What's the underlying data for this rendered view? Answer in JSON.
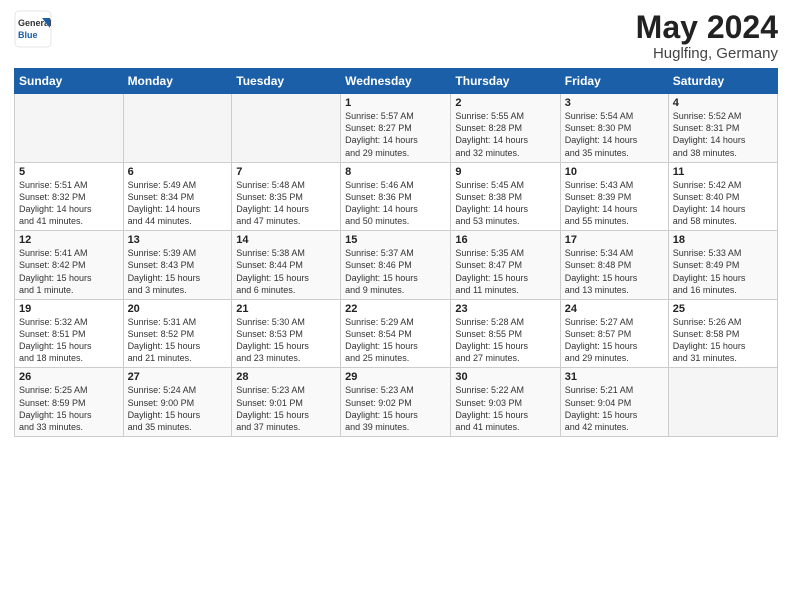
{
  "header": {
    "logo_general": "General",
    "logo_blue": "Blue",
    "title": "May 2024",
    "location": "Huglfing, Germany"
  },
  "days_of_week": [
    "Sunday",
    "Monday",
    "Tuesday",
    "Wednesday",
    "Thursday",
    "Friday",
    "Saturday"
  ],
  "weeks": [
    [
      {
        "day": "",
        "content": ""
      },
      {
        "day": "",
        "content": ""
      },
      {
        "day": "",
        "content": ""
      },
      {
        "day": "1",
        "content": "Sunrise: 5:57 AM\nSunset: 8:27 PM\nDaylight: 14 hours\nand 29 minutes."
      },
      {
        "day": "2",
        "content": "Sunrise: 5:55 AM\nSunset: 8:28 PM\nDaylight: 14 hours\nand 32 minutes."
      },
      {
        "day": "3",
        "content": "Sunrise: 5:54 AM\nSunset: 8:30 PM\nDaylight: 14 hours\nand 35 minutes."
      },
      {
        "day": "4",
        "content": "Sunrise: 5:52 AM\nSunset: 8:31 PM\nDaylight: 14 hours\nand 38 minutes."
      }
    ],
    [
      {
        "day": "5",
        "content": "Sunrise: 5:51 AM\nSunset: 8:32 PM\nDaylight: 14 hours\nand 41 minutes."
      },
      {
        "day": "6",
        "content": "Sunrise: 5:49 AM\nSunset: 8:34 PM\nDaylight: 14 hours\nand 44 minutes."
      },
      {
        "day": "7",
        "content": "Sunrise: 5:48 AM\nSunset: 8:35 PM\nDaylight: 14 hours\nand 47 minutes."
      },
      {
        "day": "8",
        "content": "Sunrise: 5:46 AM\nSunset: 8:36 PM\nDaylight: 14 hours\nand 50 minutes."
      },
      {
        "day": "9",
        "content": "Sunrise: 5:45 AM\nSunset: 8:38 PM\nDaylight: 14 hours\nand 53 minutes."
      },
      {
        "day": "10",
        "content": "Sunrise: 5:43 AM\nSunset: 8:39 PM\nDaylight: 14 hours\nand 55 minutes."
      },
      {
        "day": "11",
        "content": "Sunrise: 5:42 AM\nSunset: 8:40 PM\nDaylight: 14 hours\nand 58 minutes."
      }
    ],
    [
      {
        "day": "12",
        "content": "Sunrise: 5:41 AM\nSunset: 8:42 PM\nDaylight: 15 hours\nand 1 minute."
      },
      {
        "day": "13",
        "content": "Sunrise: 5:39 AM\nSunset: 8:43 PM\nDaylight: 15 hours\nand 3 minutes."
      },
      {
        "day": "14",
        "content": "Sunrise: 5:38 AM\nSunset: 8:44 PM\nDaylight: 15 hours\nand 6 minutes."
      },
      {
        "day": "15",
        "content": "Sunrise: 5:37 AM\nSunset: 8:46 PM\nDaylight: 15 hours\nand 9 minutes."
      },
      {
        "day": "16",
        "content": "Sunrise: 5:35 AM\nSunset: 8:47 PM\nDaylight: 15 hours\nand 11 minutes."
      },
      {
        "day": "17",
        "content": "Sunrise: 5:34 AM\nSunset: 8:48 PM\nDaylight: 15 hours\nand 13 minutes."
      },
      {
        "day": "18",
        "content": "Sunrise: 5:33 AM\nSunset: 8:49 PM\nDaylight: 15 hours\nand 16 minutes."
      }
    ],
    [
      {
        "day": "19",
        "content": "Sunrise: 5:32 AM\nSunset: 8:51 PM\nDaylight: 15 hours\nand 18 minutes."
      },
      {
        "day": "20",
        "content": "Sunrise: 5:31 AM\nSunset: 8:52 PM\nDaylight: 15 hours\nand 21 minutes."
      },
      {
        "day": "21",
        "content": "Sunrise: 5:30 AM\nSunset: 8:53 PM\nDaylight: 15 hours\nand 23 minutes."
      },
      {
        "day": "22",
        "content": "Sunrise: 5:29 AM\nSunset: 8:54 PM\nDaylight: 15 hours\nand 25 minutes."
      },
      {
        "day": "23",
        "content": "Sunrise: 5:28 AM\nSunset: 8:55 PM\nDaylight: 15 hours\nand 27 minutes."
      },
      {
        "day": "24",
        "content": "Sunrise: 5:27 AM\nSunset: 8:57 PM\nDaylight: 15 hours\nand 29 minutes."
      },
      {
        "day": "25",
        "content": "Sunrise: 5:26 AM\nSunset: 8:58 PM\nDaylight: 15 hours\nand 31 minutes."
      }
    ],
    [
      {
        "day": "26",
        "content": "Sunrise: 5:25 AM\nSunset: 8:59 PM\nDaylight: 15 hours\nand 33 minutes."
      },
      {
        "day": "27",
        "content": "Sunrise: 5:24 AM\nSunset: 9:00 PM\nDaylight: 15 hours\nand 35 minutes."
      },
      {
        "day": "28",
        "content": "Sunrise: 5:23 AM\nSunset: 9:01 PM\nDaylight: 15 hours\nand 37 minutes."
      },
      {
        "day": "29",
        "content": "Sunrise: 5:23 AM\nSunset: 9:02 PM\nDaylight: 15 hours\nand 39 minutes."
      },
      {
        "day": "30",
        "content": "Sunrise: 5:22 AM\nSunset: 9:03 PM\nDaylight: 15 hours\nand 41 minutes."
      },
      {
        "day": "31",
        "content": "Sunrise: 5:21 AM\nSunset: 9:04 PM\nDaylight: 15 hours\nand 42 minutes."
      },
      {
        "day": "",
        "content": ""
      }
    ]
  ]
}
